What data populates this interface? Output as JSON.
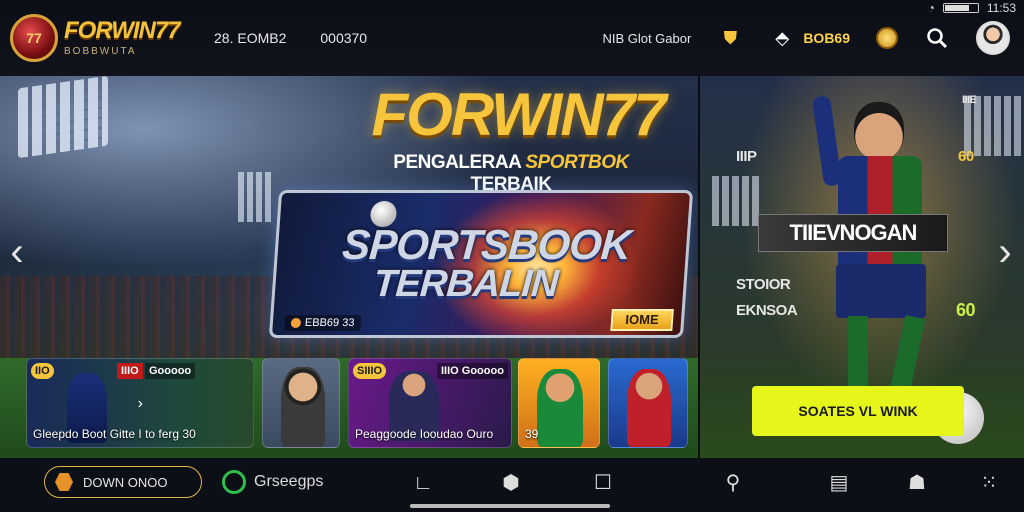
{
  "status_bar": {
    "time": "11:53"
  },
  "header": {
    "logo_title": "FORWIN77",
    "logo_subtitle": "BOBBWUTA",
    "stat1": "28. EOMB2",
    "stat2": "000370",
    "language": "NIB Glot Gabor",
    "balance": "BOB69",
    "icons": [
      "shield-icon",
      "gift-icon",
      "coin-icon",
      "search-icon"
    ]
  },
  "hero": {
    "title": "FORWIN77",
    "subtitle_prefix": "PENGALERAA ",
    "subtitle_highlight": "SPORTBOK",
    "subtitle_suffix": " TERBAIK",
    "sportsbook": {
      "line1": "SPORTSBOOK",
      "line2": "TERBALIN",
      "chip": "EBB69 33",
      "button": "IOME"
    }
  },
  "feature": {
    "tag1": "IIIP",
    "tag2": "IIIE",
    "tag3": "60",
    "banner": "TIIEVNOGAN",
    "stat_a": "STOIOR",
    "stat_b": "EKNSOA",
    "stat_c": "60",
    "cta": "SOATES VL WINK"
  },
  "cards": {
    "card1_tag1": "IIO",
    "card1_tag2": "IIIO",
    "card1_tag3": "Gooooo",
    "card1_caption": "Gleepdo Boot Gitte I to ferg 30",
    "card3_tag1": "SIIIO",
    "card3_tag2": "IIIO Gooooo",
    "card3_caption": "Peaggoode Iooudao Ouro",
    "card4_caption": "39"
  },
  "bottom": {
    "download": "DOWN ONOO",
    "app": "Grseegps"
  }
}
